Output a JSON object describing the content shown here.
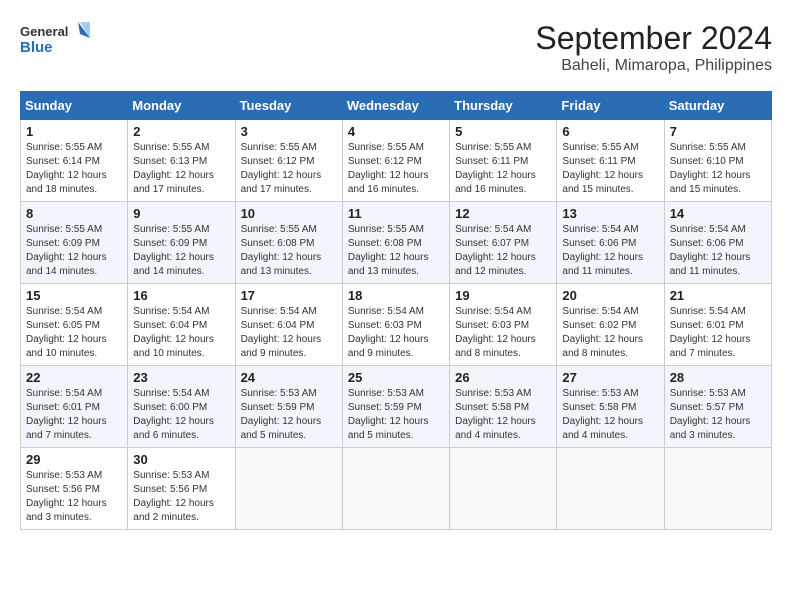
{
  "header": {
    "logo_line1": "General",
    "logo_line2": "Blue",
    "month": "September 2024",
    "location": "Baheli, Mimaropa, Philippines"
  },
  "weekdays": [
    "Sunday",
    "Monday",
    "Tuesday",
    "Wednesday",
    "Thursday",
    "Friday",
    "Saturday"
  ],
  "weeks": [
    [
      {
        "day": "1",
        "sunrise": "5:55 AM",
        "sunset": "6:14 PM",
        "daylight": "12 hours and 18 minutes."
      },
      {
        "day": "2",
        "sunrise": "5:55 AM",
        "sunset": "6:13 PM",
        "daylight": "12 hours and 17 minutes."
      },
      {
        "day": "3",
        "sunrise": "5:55 AM",
        "sunset": "6:12 PM",
        "daylight": "12 hours and 17 minutes."
      },
      {
        "day": "4",
        "sunrise": "5:55 AM",
        "sunset": "6:12 PM",
        "daylight": "12 hours and 16 minutes."
      },
      {
        "day": "5",
        "sunrise": "5:55 AM",
        "sunset": "6:11 PM",
        "daylight": "12 hours and 16 minutes."
      },
      {
        "day": "6",
        "sunrise": "5:55 AM",
        "sunset": "6:11 PM",
        "daylight": "12 hours and 15 minutes."
      },
      {
        "day": "7",
        "sunrise": "5:55 AM",
        "sunset": "6:10 PM",
        "daylight": "12 hours and 15 minutes."
      }
    ],
    [
      {
        "day": "8",
        "sunrise": "5:55 AM",
        "sunset": "6:09 PM",
        "daylight": "12 hours and 14 minutes."
      },
      {
        "day": "9",
        "sunrise": "5:55 AM",
        "sunset": "6:09 PM",
        "daylight": "12 hours and 14 minutes."
      },
      {
        "day": "10",
        "sunrise": "5:55 AM",
        "sunset": "6:08 PM",
        "daylight": "12 hours and 13 minutes."
      },
      {
        "day": "11",
        "sunrise": "5:55 AM",
        "sunset": "6:08 PM",
        "daylight": "12 hours and 13 minutes."
      },
      {
        "day": "12",
        "sunrise": "5:54 AM",
        "sunset": "6:07 PM",
        "daylight": "12 hours and 12 minutes."
      },
      {
        "day": "13",
        "sunrise": "5:54 AM",
        "sunset": "6:06 PM",
        "daylight": "12 hours and 11 minutes."
      },
      {
        "day": "14",
        "sunrise": "5:54 AM",
        "sunset": "6:06 PM",
        "daylight": "12 hours and 11 minutes."
      }
    ],
    [
      {
        "day": "15",
        "sunrise": "5:54 AM",
        "sunset": "6:05 PM",
        "daylight": "12 hours and 10 minutes."
      },
      {
        "day": "16",
        "sunrise": "5:54 AM",
        "sunset": "6:04 PM",
        "daylight": "12 hours and 10 minutes."
      },
      {
        "day": "17",
        "sunrise": "5:54 AM",
        "sunset": "6:04 PM",
        "daylight": "12 hours and 9 minutes."
      },
      {
        "day": "18",
        "sunrise": "5:54 AM",
        "sunset": "6:03 PM",
        "daylight": "12 hours and 9 minutes."
      },
      {
        "day": "19",
        "sunrise": "5:54 AM",
        "sunset": "6:03 PM",
        "daylight": "12 hours and 8 minutes."
      },
      {
        "day": "20",
        "sunrise": "5:54 AM",
        "sunset": "6:02 PM",
        "daylight": "12 hours and 8 minutes."
      },
      {
        "day": "21",
        "sunrise": "5:54 AM",
        "sunset": "6:01 PM",
        "daylight": "12 hours and 7 minutes."
      }
    ],
    [
      {
        "day": "22",
        "sunrise": "5:54 AM",
        "sunset": "6:01 PM",
        "daylight": "12 hours and 7 minutes."
      },
      {
        "day": "23",
        "sunrise": "5:54 AM",
        "sunset": "6:00 PM",
        "daylight": "12 hours and 6 minutes."
      },
      {
        "day": "24",
        "sunrise": "5:53 AM",
        "sunset": "5:59 PM",
        "daylight": "12 hours and 5 minutes."
      },
      {
        "day": "25",
        "sunrise": "5:53 AM",
        "sunset": "5:59 PM",
        "daylight": "12 hours and 5 minutes."
      },
      {
        "day": "26",
        "sunrise": "5:53 AM",
        "sunset": "5:58 PM",
        "daylight": "12 hours and 4 minutes."
      },
      {
        "day": "27",
        "sunrise": "5:53 AM",
        "sunset": "5:58 PM",
        "daylight": "12 hours and 4 minutes."
      },
      {
        "day": "28",
        "sunrise": "5:53 AM",
        "sunset": "5:57 PM",
        "daylight": "12 hours and 3 minutes."
      }
    ],
    [
      {
        "day": "29",
        "sunrise": "5:53 AM",
        "sunset": "5:56 PM",
        "daylight": "12 hours and 3 minutes."
      },
      {
        "day": "30",
        "sunrise": "5:53 AM",
        "sunset": "5:56 PM",
        "daylight": "12 hours and 2 minutes."
      },
      null,
      null,
      null,
      null,
      null
    ]
  ]
}
